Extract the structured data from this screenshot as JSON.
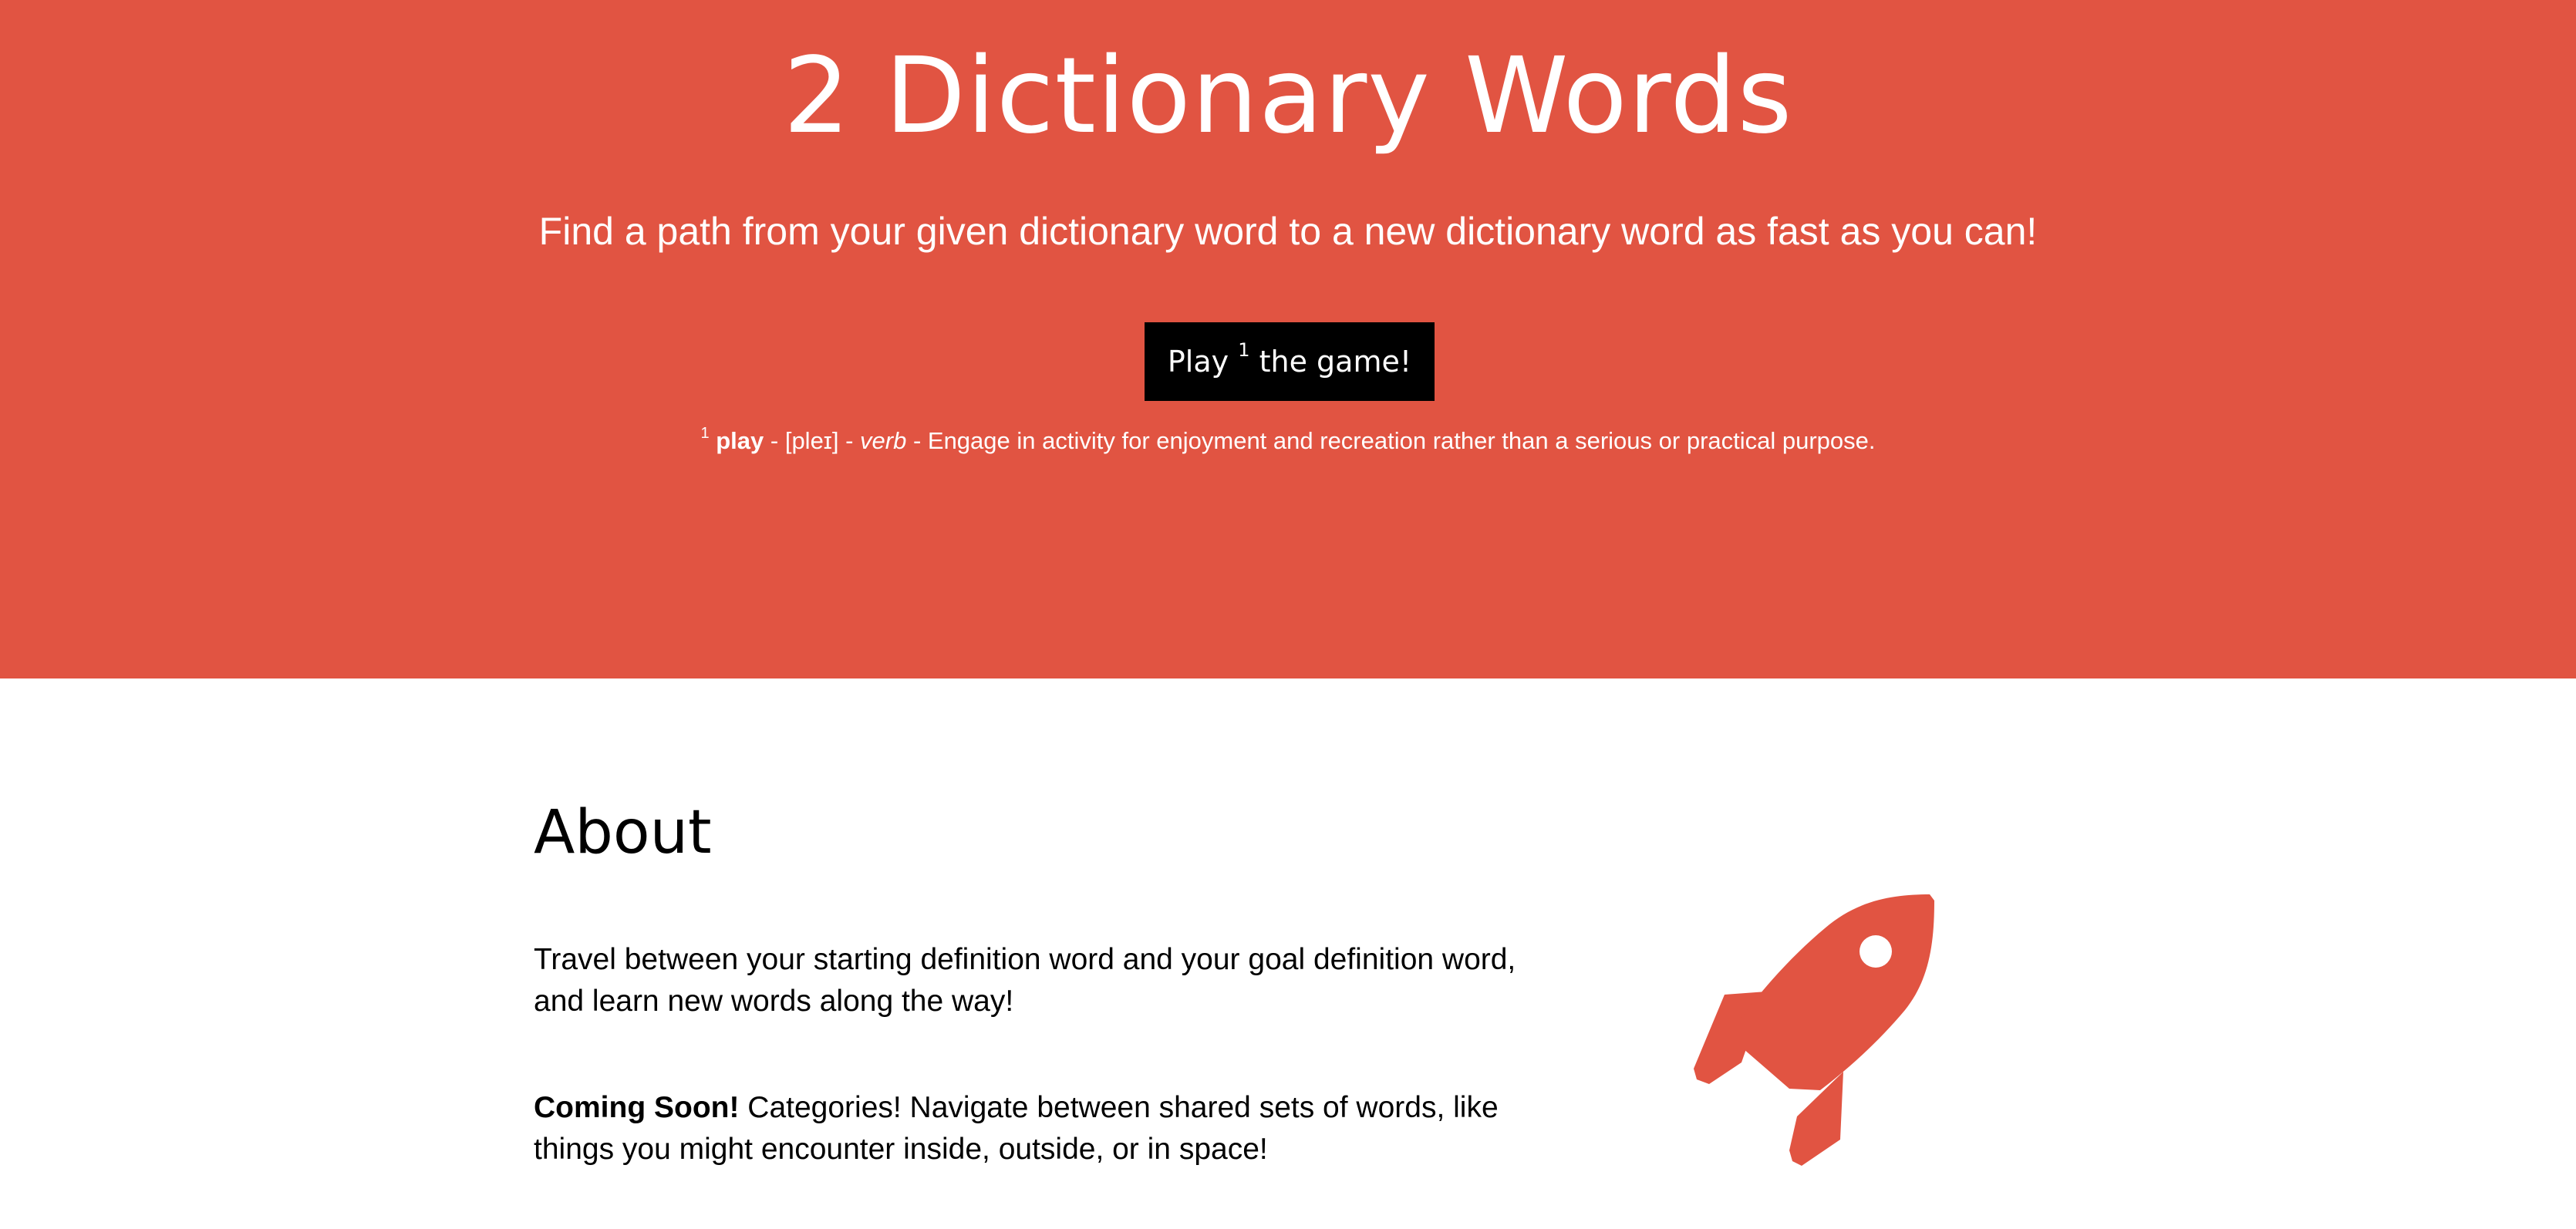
{
  "hero": {
    "title": "2 Dictionary Words",
    "subtitle": "Find a path from your given dictionary word to a new dictionary word as fast as you can!",
    "button": {
      "label_before": "Play",
      "footnote_marker": "1",
      "label_after": "the game!"
    },
    "footnote": {
      "marker": "1",
      "word": "play",
      "sep1": " - ",
      "pronunciation": "[pleɪ]",
      "sep2": " - ",
      "part_of_speech": "verb",
      "definition": " - Engage in activity for enjoyment and recreation rather than a serious or practical purpose."
    }
  },
  "about": {
    "title": "About",
    "paragraph1": "Travel between your starting definition word and your goal definition word, and learn new words along the way!",
    "paragraph2_bold": "Coming Soon!",
    "paragraph2": " Categories! Navigate between shared sets of words, like things you might encounter inside, outside, or in space!"
  },
  "icons": {
    "rocket": "rocket-icon"
  },
  "colors": {
    "brand_red": "#e15442",
    "button_black": "#000000",
    "text_white": "#ffffff"
  }
}
